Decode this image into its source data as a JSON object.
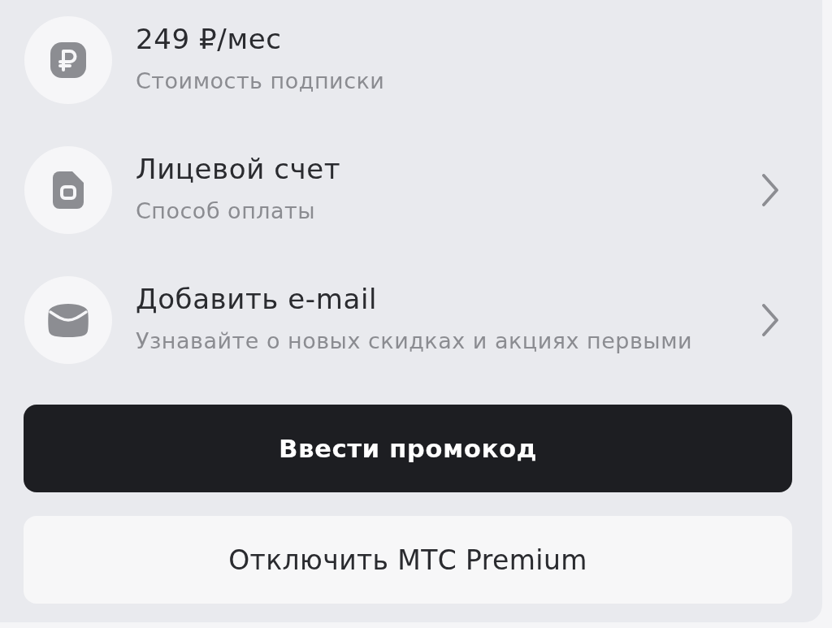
{
  "rows": [
    {
      "kind": "price",
      "title": "249 ₽/мес",
      "subtitle": "Стоимость подписки",
      "chevron": false
    },
    {
      "kind": "account",
      "title": "Лицевой счет",
      "subtitle": "Способ оплаты",
      "chevron": true
    },
    {
      "kind": "email",
      "title": "Добавить e-mail",
      "subtitle": "Узнавайте о новых скидках и акциях первыми",
      "chevron": true
    }
  ],
  "buttons": [
    {
      "kind": "primary",
      "label": "Ввести промокод"
    },
    {
      "kind": "secondary",
      "label": "Отключить МТС Premium"
    }
  ]
}
